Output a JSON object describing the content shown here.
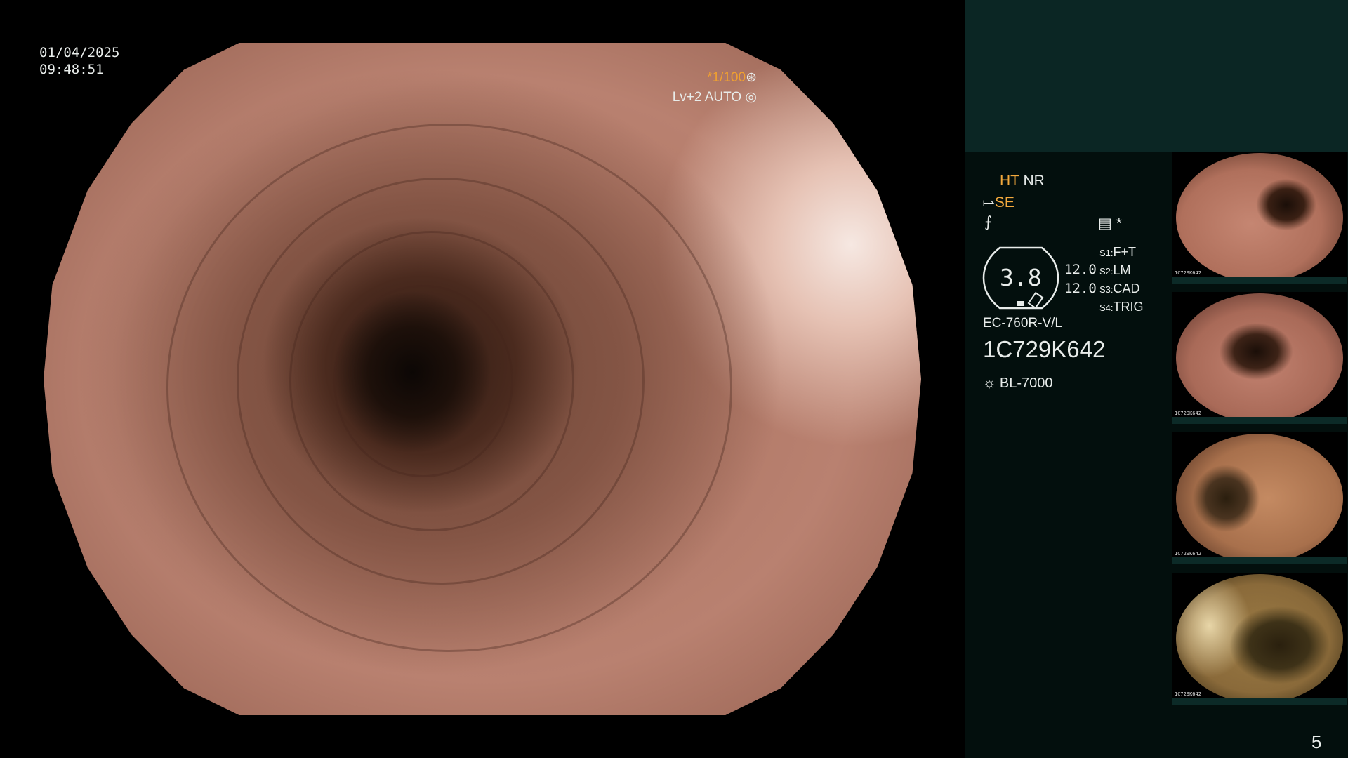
{
  "overlay": {
    "date": "01/04/2025",
    "time": "09:48:51",
    "shutter": "*1/100",
    "level": "Lv+2 AUTO"
  },
  "panel": {
    "ht": "HT",
    "nr": "NR",
    "se": "SE",
    "scale_value": "3.8",
    "val1": "12.0",
    "val2": "12.0",
    "s1_key": "S1:",
    "s1_val": "F+T",
    "s2_key": "S2:",
    "s2_val": "LM",
    "s3_key": "S3:",
    "s3_val": "CAD",
    "s4_key": "S4:",
    "s4_val": "TRIG",
    "scope_model": "EC-760R-V/L",
    "serial": "1C729K642",
    "light_source": "BL-7000",
    "page_number": "5"
  },
  "thumbnails": [
    {
      "id": "1C729K642",
      "tone": "#b0705c"
    },
    {
      "id": "1C729K642",
      "tone": "#a96a58"
    },
    {
      "id": "1C729K642",
      "tone": "#a8704c"
    },
    {
      "id": "1C729K642",
      "tone": "#8a6a3a"
    }
  ],
  "colors": {
    "accent": "#f3a93d",
    "panel_top": "#0b2624",
    "panel": "#030f0d"
  }
}
